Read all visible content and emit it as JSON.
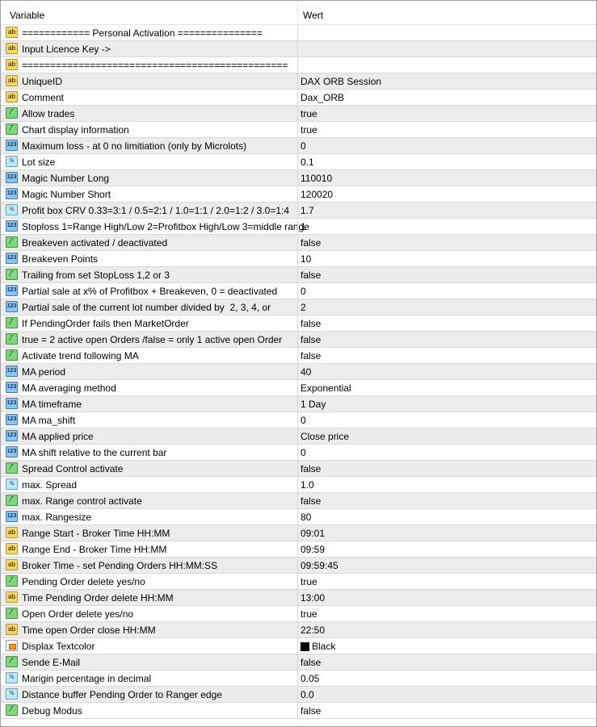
{
  "header": {
    "variable": "Variable",
    "value": "Wert"
  },
  "icon_types": {
    "str": "ab",
    "bool": "bool-icon",
    "int": "123",
    "dbl": "½",
    "color": "color-icon"
  },
  "rows": [
    {
      "type": "str",
      "name": "============ Personal Activation ===============",
      "value": ""
    },
    {
      "type": "str",
      "name": "Input Licence Key ->",
      "value": ""
    },
    {
      "type": "str",
      "name": "===============================================",
      "value": ""
    },
    {
      "type": "str",
      "name": "UniqueID",
      "value": "DAX ORB Session"
    },
    {
      "type": "str",
      "name": "Comment",
      "value": "Dax_ORB"
    },
    {
      "type": "bool",
      "name": "Allow trades",
      "value": "true"
    },
    {
      "type": "bool",
      "name": "Chart display information",
      "value": "true"
    },
    {
      "type": "int",
      "name": "Maximum loss - at 0 no limitiation (only by Microlots)",
      "value": "0"
    },
    {
      "type": "dbl",
      "name": "Lot size",
      "value": "0.1"
    },
    {
      "type": "int",
      "name": "Magic Number Long",
      "value": "110010"
    },
    {
      "type": "int",
      "name": "Magic Number Short",
      "value": "120020"
    },
    {
      "type": "dbl",
      "name": "Profit box CRV 0.33=3:1 / 0.5=2:1 / 1.0=1:1 / 2.0=1:2 / 3.0=1:4",
      "value": "1.7"
    },
    {
      "type": "int",
      "name": "Stoploss 1=Range High/Low 2=Profitbox High/Low 3=middle range",
      "value": "1"
    },
    {
      "type": "bool",
      "name": "Breakeven activated / deactivated",
      "value": "false"
    },
    {
      "type": "int",
      "name": "Breakeven Points",
      "value": "10"
    },
    {
      "type": "bool",
      "name": "Trailing from set StopLoss 1,2 or 3",
      "value": "false"
    },
    {
      "type": "int",
      "name": "Partial sale at x% of Profitbox + Breakeven, 0 = deactivated",
      "value": "0"
    },
    {
      "type": "int",
      "name": "Partial sale of the current lot number divided by  2, 3, 4, or",
      "value": "2"
    },
    {
      "type": "bool",
      "name": "If PendingOrder fails then MarketOrder",
      "value": "false"
    },
    {
      "type": "bool",
      "name": "true = 2 active open Orders /false = only 1 active open Order",
      "value": "false"
    },
    {
      "type": "bool",
      "name": "Activate trend following MA",
      "value": "false"
    },
    {
      "type": "int",
      "name": "MA period",
      "value": "40"
    },
    {
      "type": "int",
      "name": "MA averaging method",
      "value": "Exponential"
    },
    {
      "type": "int",
      "name": "MA timeframe",
      "value": "1 Day"
    },
    {
      "type": "int",
      "name": "MA ma_shift",
      "value": "0"
    },
    {
      "type": "int",
      "name": "MA applied price",
      "value": "Close price"
    },
    {
      "type": "int",
      "name": "MA shift relative to the current bar",
      "value": "0"
    },
    {
      "type": "bool",
      "name": "Spread Control activate",
      "value": "false"
    },
    {
      "type": "dbl",
      "name": "max. Spread",
      "value": "1.0"
    },
    {
      "type": "bool",
      "name": "max. Range control activate",
      "value": "false"
    },
    {
      "type": "int",
      "name": "max. Rangesize",
      "value": "80"
    },
    {
      "type": "str",
      "name": "Range Start - Broker Time HH:MM",
      "value": "09:01"
    },
    {
      "type": "str",
      "name": "Range End - Broker Time HH:MM",
      "value": "09:59"
    },
    {
      "type": "str",
      "name": "Broker Time - set Pending Orders HH:MM:SS",
      "value": "09:59:45"
    },
    {
      "type": "bool",
      "name": "Pending Order delete yes/no",
      "value": "true"
    },
    {
      "type": "str",
      "name": "Time Pending Order delete HH:MM",
      "value": "13:00"
    },
    {
      "type": "bool",
      "name": "Open Order delete yes/no",
      "value": "true"
    },
    {
      "type": "str",
      "name": "Time open Order close HH:MM",
      "value": "22:50"
    },
    {
      "type": "color",
      "name": "Displax Textcolor",
      "value": "Black",
      "swatch": "#000000"
    },
    {
      "type": "bool",
      "name": "Sende E-Mail",
      "value": "false"
    },
    {
      "type": "dbl",
      "name": "Marigin percentage in decimal",
      "value": "0.05"
    },
    {
      "type": "dbl",
      "name": "Distance buffer Pending Order to Ranger edge",
      "value": "0.0"
    },
    {
      "type": "bool",
      "name": "Debug Modus",
      "value": "false"
    }
  ]
}
